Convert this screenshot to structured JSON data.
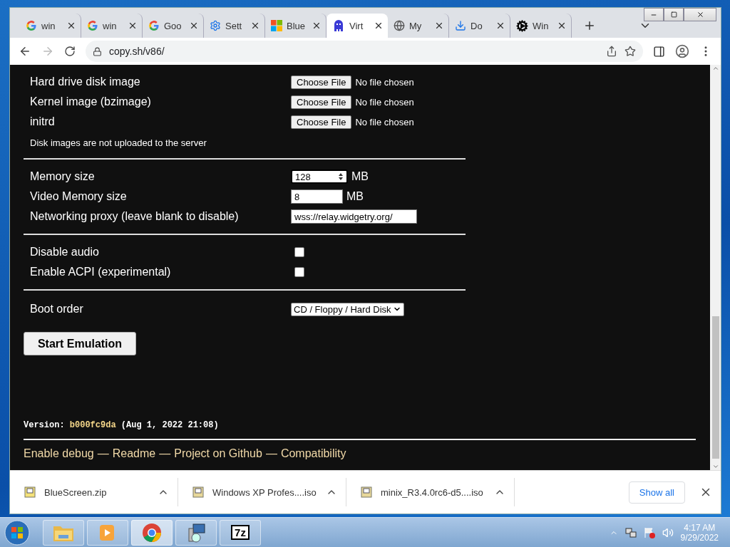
{
  "tabs": [
    {
      "title": "win",
      "kind": "google",
      "selected": false
    },
    {
      "title": "win",
      "kind": "google",
      "selected": false
    },
    {
      "title": "Goo",
      "kind": "google",
      "selected": false
    },
    {
      "title": "Sett",
      "kind": "gear",
      "selected": false
    },
    {
      "title": "Blue",
      "kind": "windows",
      "selected": false
    },
    {
      "title": "Virt",
      "kind": "v86",
      "selected": true
    },
    {
      "title": "My",
      "kind": "globe",
      "selected": false
    },
    {
      "title": "Do",
      "kind": "download",
      "selected": false
    },
    {
      "title": "Win",
      "kind": "cog",
      "selected": false
    }
  ],
  "address": "copy.sh/v86/",
  "file_rows": [
    {
      "label": "Hard drive disk image",
      "button": "Choose File",
      "status": "No file chosen"
    },
    {
      "label": "Kernel image (bzimage)",
      "button": "Choose File",
      "status": "No file chosen"
    },
    {
      "label": "initrd",
      "button": "Choose File",
      "status": "No file chosen"
    }
  ],
  "note": "Disk images are not uploaded to the server",
  "settings": [
    {
      "label": "Memory size",
      "value": "128",
      "unit": "MB",
      "kind": "spinner"
    },
    {
      "label": "Video Memory size",
      "value": "8",
      "unit": "MB",
      "kind": "number"
    },
    {
      "label": "Networking proxy (leave blank to disable)",
      "value": "wss://relay.widgetry.org/",
      "kind": "text"
    }
  ],
  "options": [
    {
      "label": "Disable audio",
      "checked": false
    },
    {
      "label": "Enable ACPI (experimental)",
      "checked": false
    }
  ],
  "boot": {
    "label": "Boot order",
    "value": "CD / Floppy / Hard Disk"
  },
  "start_button": "Start Emulation",
  "version": {
    "label": "Version:",
    "commit": "b000fc9da",
    "date": "(Aug 1, 2022 21:08)"
  },
  "footer": [
    {
      "text": "Enable debug"
    },
    {
      "separator": "—",
      "text": "Readme"
    },
    {
      "separator": "—",
      "text": "Project on Github"
    },
    {
      "separator": "—",
      "text": "Compatibility"
    }
  ],
  "downloads": [
    {
      "name": "BlueScreen.zip",
      "kind": "zip"
    },
    {
      "name": "Windows XP Profes....iso",
      "kind": "iso"
    },
    {
      "name": "minix_R3.4.0rc6-d5....iso",
      "kind": "iso"
    }
  ],
  "show_all": "Show all",
  "taskbar": [
    {
      "kind": "explorer",
      "selected": false
    },
    {
      "kind": "media",
      "selected": false
    },
    {
      "kind": "chrome",
      "selected": true
    },
    {
      "kind": "setup",
      "selected": false
    },
    {
      "kind": "sevenzip",
      "label": "7z",
      "selected": false
    }
  ],
  "clock": {
    "time": "4:17 AM",
    "date": "9/29/2022"
  }
}
